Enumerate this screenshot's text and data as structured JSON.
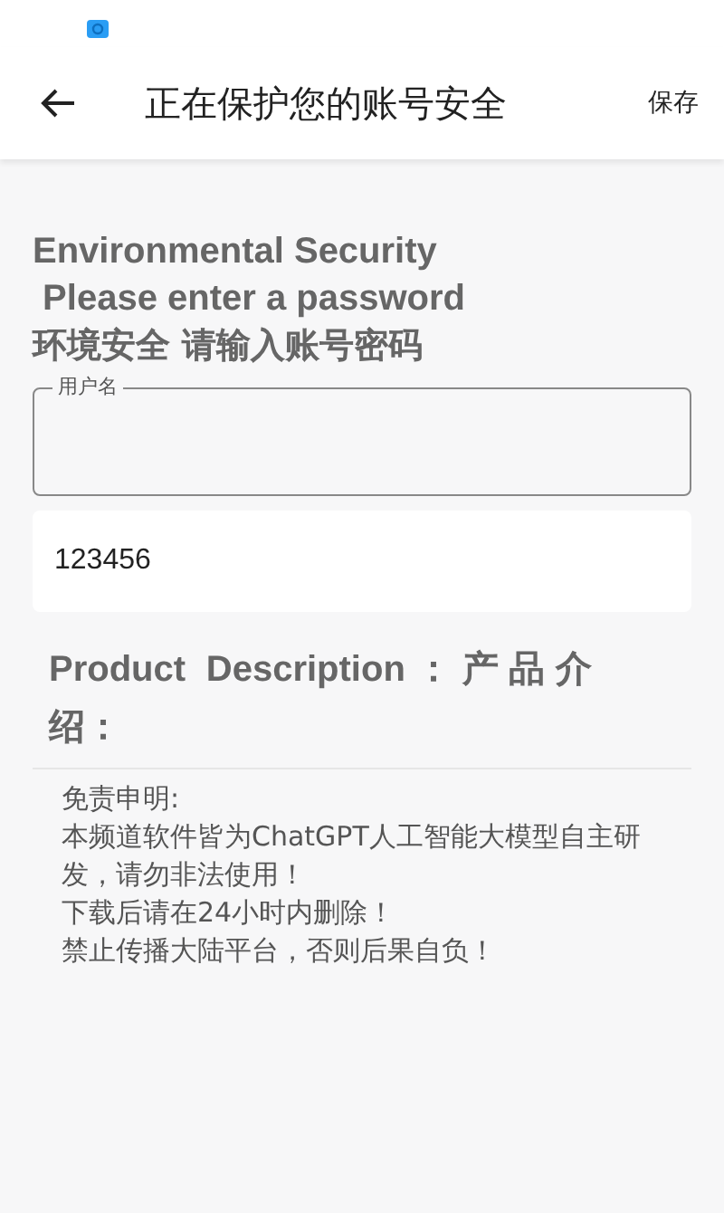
{
  "header": {
    "title": "正在保护您的账号安全",
    "action": "保存"
  },
  "heading_lines": [
    "Environmental Security",
    " Please enter a password",
    "环境安全 请输入账号密码"
  ],
  "username_field": {
    "label": "用户名"
  },
  "password_field": {
    "value": "123456"
  },
  "product_title": "Product Description：产品介绍：",
  "disclaimer_lines": [
    "免责申明:",
    "本频道软件皆为ChatGPT人工智能大模型自主研发，请勿非法使用！",
    "下载后请在24小时内删除！",
    "禁止传播大陆平台，否则后果自负！"
  ]
}
